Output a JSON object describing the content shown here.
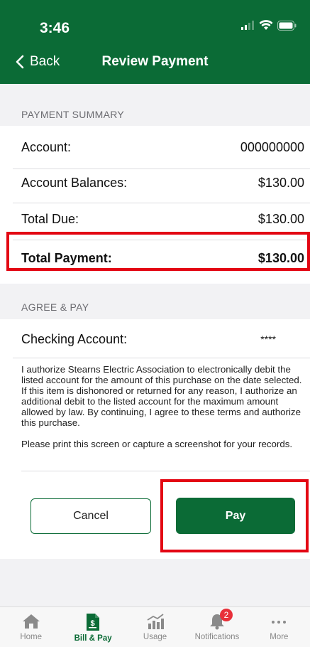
{
  "status_bar": {
    "time": "3:46"
  },
  "nav": {
    "back_label": "Back",
    "title": "Review Payment"
  },
  "payment_summary": {
    "section_label": "PAYMENT SUMMARY",
    "rows": [
      {
        "label": "Account:",
        "value": "000000000"
      },
      {
        "label": "Account Balances:",
        "value": "$130.00"
      },
      {
        "label": "Total Due:",
        "value": "$130.00"
      },
      {
        "label": "Total Payment:",
        "value": "$130.00"
      }
    ]
  },
  "agree_pay": {
    "section_label": "AGREE & PAY",
    "checking_label": "Checking Account:",
    "checking_value": "****",
    "authorization_text": "I authorize Stearns Electric Association to electronically debit the listed account for the amount of this purchase on the date selected. If this item is dishonored or returned for any reason, I authorize an additional debit to the listed account for the maximum amount allowed by law. By continuing, I agree to these terms and authorize this purchase.",
    "print_note": "Please print this screen or capture a screenshot for your records."
  },
  "actions": {
    "cancel_label": "Cancel",
    "pay_label": "Pay"
  },
  "tabbar": {
    "tabs": [
      {
        "label": "Home",
        "icon": "home-icon"
      },
      {
        "label": "Bill & Pay",
        "icon": "bill-icon",
        "active": true
      },
      {
        "label": "Usage",
        "icon": "usage-chart-icon"
      },
      {
        "label": "Notifications",
        "icon": "bell-icon",
        "badge": "2"
      },
      {
        "label": "More",
        "icon": "more-icon"
      }
    ]
  },
  "colors": {
    "brand_green": "#0b6b36",
    "highlight_red": "#e30613",
    "badge_red": "#e8303a"
  }
}
